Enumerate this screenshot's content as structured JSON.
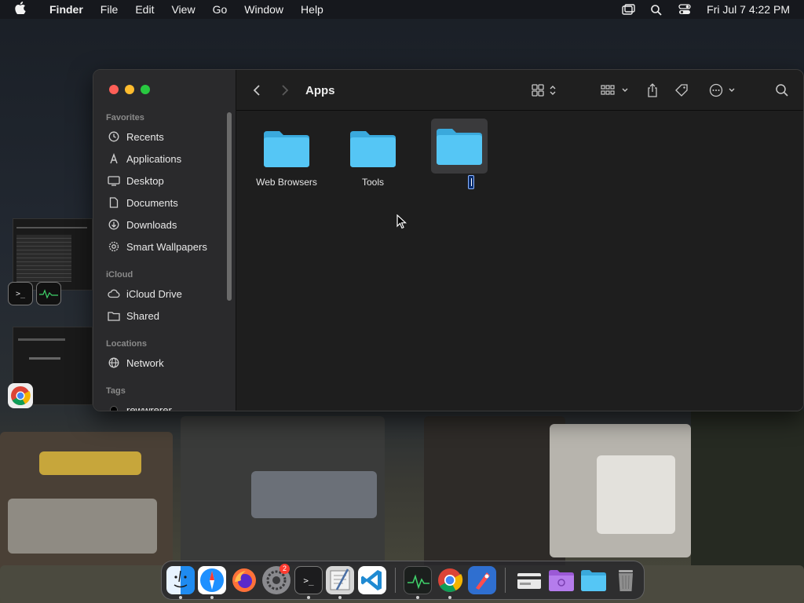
{
  "menubar": {
    "app_name": "Finder",
    "menus": [
      "File",
      "Edit",
      "View",
      "Go",
      "Window",
      "Help"
    ],
    "clock": "Fri Jul 7  4:22 PM",
    "status_icons": [
      "screen-mirroring-icon",
      "spotlight-icon",
      "control-center-icon"
    ]
  },
  "finder": {
    "title": "Apps",
    "sidebar": {
      "favorites_title": "Favorites",
      "favorites": [
        {
          "label": "Recents",
          "icon": "clock-icon"
        },
        {
          "label": "Applications",
          "icon": "applications-icon"
        },
        {
          "label": "Desktop",
          "icon": "desktop-icon"
        },
        {
          "label": "Documents",
          "icon": "document-icon"
        },
        {
          "label": "Downloads",
          "icon": "download-icon"
        },
        {
          "label": "Smart Wallpapers",
          "icon": "gear-icon"
        }
      ],
      "icloud_title": "iCloud",
      "icloud": [
        {
          "label": "iCloud Drive",
          "icon": "cloud-icon"
        },
        {
          "label": "Shared",
          "icon": "shared-folder-icon"
        }
      ],
      "locations_title": "Locations",
      "locations": [
        {
          "label": "Network",
          "icon": "globe-icon"
        }
      ],
      "tags_title": "Tags",
      "tags": [
        {
          "label": "rewwrerer",
          "color": "#000000"
        }
      ]
    },
    "files": [
      {
        "name": "Web Browsers",
        "selected": false
      },
      {
        "name": "Tools",
        "selected": false
      },
      {
        "name": "",
        "selected": true,
        "renaming": true
      }
    ]
  },
  "dock": {
    "badge_count": "2",
    "apps": [
      "finder",
      "safari",
      "firefox",
      "system-settings",
      "terminal",
      "script-editor",
      "vscode",
      "activity-monitor",
      "chrome",
      "rocket-typist",
      "card-app",
      "purple-folder",
      "folder",
      "trash"
    ]
  },
  "colors": {
    "folder_blue": "#4cc1f2",
    "close": "#ff5f57",
    "minimize": "#febc2e",
    "zoom": "#28c840"
  }
}
